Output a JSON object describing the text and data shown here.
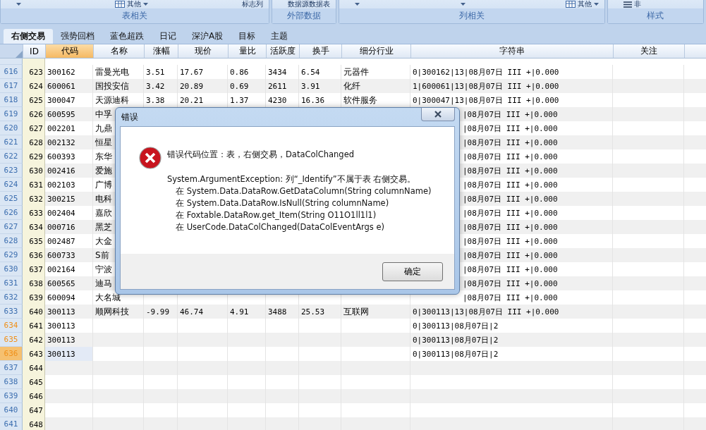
{
  "ribbon": {
    "groups": [
      {
        "label": "表相关",
        "items": [
          {
            "kind": "caret"
          },
          {
            "kind": "menu",
            "label": "其他"
          },
          {
            "kind": "text",
            "label": "标志列"
          }
        ]
      },
      {
        "label": "外部数据",
        "items": [
          {
            "kind": "text",
            "label": "数据源"
          },
          {
            "kind": "text",
            "label": "数据表"
          }
        ]
      },
      {
        "label": "列相关",
        "items": [
          {
            "kind": "caret"
          },
          {
            "kind": "caret"
          },
          {
            "kind": "menu",
            "label": "其他"
          }
        ]
      },
      {
        "label": "样式",
        "items": [
          {
            "kind": "list",
            "label": "非"
          }
        ]
      }
    ]
  },
  "tabs": [
    {
      "label": "右侧交易",
      "selected": true
    },
    {
      "label": "强势回档",
      "selected": false
    },
    {
      "label": "蓝色超跌",
      "selected": false
    },
    {
      "label": "日记",
      "selected": false
    },
    {
      "label": "深沪A股",
      "selected": false
    },
    {
      "label": "目标",
      "selected": false
    },
    {
      "label": "主题",
      "selected": false
    }
  ],
  "table": {
    "columns": [
      {
        "label": "ID",
        "selected": false
      },
      {
        "label": "代码",
        "selected": true
      },
      {
        "label": "名称",
        "selected": false
      },
      {
        "label": "涨幅",
        "selected": false
      },
      {
        "label": "现价",
        "selected": false
      },
      {
        "label": "量比",
        "selected": false
      },
      {
        "label": "活跃度",
        "selected": false
      },
      {
        "label": "换手",
        "selected": false
      },
      {
        "label": "细分行业",
        "selected": false
      },
      {
        "label": "字符串",
        "selected": false
      },
      {
        "label": "关注",
        "selected": false
      }
    ],
    "rows": [
      {
        "kind": "full",
        "no": "616",
        "id": "623",
        "code": "300162",
        "name": "雷曼光电",
        "change": "3.51",
        "price": "17.67",
        "volume_ratio": "0.86",
        "activity": "3434",
        "turnover": "6.54",
        "industry": "元器件",
        "string": "0|300162|13|08月07日 III +|0.000",
        "changed": false,
        "selected": false
      },
      {
        "kind": "full",
        "no": "617",
        "id": "624",
        "code": "600061",
        "name": "国投安信",
        "change": "3.42",
        "price": "20.89",
        "volume_ratio": "0.69",
        "activity": "2611",
        "turnover": "3.91",
        "industry": "化纤",
        "string": "1|600061|13|08月07日 III +|0.000",
        "changed": false,
        "selected": false
      },
      {
        "kind": "full",
        "no": "618",
        "id": "625",
        "code": "300047",
        "name": "天源迪科",
        "change": "3.38",
        "price": "20.21",
        "volume_ratio": "1.37",
        "activity": "4230",
        "turnover": "16.36",
        "industry": "软件服务",
        "string": "0|300047|13|08月07日 III +|0.000",
        "changed": false,
        "selected": false
      },
      {
        "kind": "covered",
        "no": "619",
        "id": "626",
        "code": "600595",
        "name": "中孚",
        "string": "|08月07日 III +|0.000",
        "changed": false,
        "selected": false
      },
      {
        "kind": "covered",
        "no": "620",
        "id": "627",
        "code": "002201",
        "name": "九鼎",
        "string": "|08月07日 III +|0.000",
        "changed": false,
        "selected": false
      },
      {
        "kind": "covered",
        "no": "621",
        "id": "628",
        "code": "002132",
        "name": "恒星",
        "string": "|08月07日 III +|0.000",
        "changed": false,
        "selected": false
      },
      {
        "kind": "covered",
        "no": "622",
        "id": "629",
        "code": "600393",
        "name": "东华",
        "string": "|08月07日 III +|0.000",
        "changed": false,
        "selected": false
      },
      {
        "kind": "covered",
        "no": "623",
        "id": "630",
        "code": "002416",
        "name": "爱施",
        "string": "|08月07日 III +|0.000",
        "changed": false,
        "selected": false
      },
      {
        "kind": "covered",
        "no": "624",
        "id": "631",
        "code": "002103",
        "name": "广博",
        "string": "|08月07日 III +|0.000",
        "changed": false,
        "selected": false
      },
      {
        "kind": "covered",
        "no": "625",
        "id": "632",
        "code": "300215",
        "name": "电科",
        "string": "|08月07日 III +|0.000",
        "changed": false,
        "selected": false
      },
      {
        "kind": "covered",
        "no": "626",
        "id": "633",
        "code": "002404",
        "name": "嘉欣",
        "string": "|08月07日 III +|0.000",
        "changed": false,
        "selected": false
      },
      {
        "kind": "covered",
        "no": "627",
        "id": "634",
        "code": "000716",
        "name": "黑芝",
        "string": "|08月07日 III +|0.000",
        "changed": false,
        "selected": false
      },
      {
        "kind": "covered",
        "no": "628",
        "id": "635",
        "code": "002487",
        "name": "大金",
        "string": "|08月07日 III +|0.000",
        "changed": false,
        "selected": false
      },
      {
        "kind": "covered",
        "no": "629",
        "id": "636",
        "code": "600733",
        "name": "S前",
        "string": "|08月07日 III +|0.000",
        "changed": false,
        "selected": false
      },
      {
        "kind": "covered",
        "no": "630",
        "id": "637",
        "code": "002164",
        "name": "宁波",
        "string": "|08月07日 III +|0.000",
        "changed": false,
        "selected": false
      },
      {
        "kind": "covered",
        "no": "631",
        "id": "638",
        "code": "600565",
        "name": "迪马",
        "string": "|08月07日 III +|0.000",
        "changed": false,
        "selected": false
      },
      {
        "kind": "covered",
        "no": "632",
        "id": "639",
        "code": "600094",
        "name": "大名城",
        "string": "|08月07日 III +|0.000",
        "changed": false,
        "selected": false
      },
      {
        "kind": "full",
        "no": "633",
        "id": "640",
        "code": "300113",
        "name": "顺网科技",
        "change": "-9.99",
        "price": "46.74",
        "volume_ratio": "4.91",
        "activity": "3488",
        "turnover": "25.53",
        "industry": "互联网",
        "string": "0|300113|13|08月07日 III +|0.000",
        "changed": false,
        "selected": false
      },
      {
        "kind": "full",
        "no": "634",
        "id": "641",
        "code": "300113",
        "string": "0|300113|08月07日|2",
        "changed": true,
        "selected": false
      },
      {
        "kind": "full",
        "no": "635",
        "id": "642",
        "code": "300113",
        "string": "0|300113|08月07日|2",
        "changed": true,
        "selected": false
      },
      {
        "kind": "full",
        "no": "636",
        "id": "643",
        "code": "300113",
        "string": "0|300113|08月07日|2",
        "changed": true,
        "selected": true
      },
      {
        "kind": "full",
        "no": "637",
        "id": "644",
        "changed": false,
        "selected": false
      },
      {
        "kind": "full",
        "no": "638",
        "id": "645",
        "changed": false,
        "selected": false
      },
      {
        "kind": "full",
        "no": "639",
        "id": "646",
        "changed": false,
        "selected": false
      },
      {
        "kind": "full",
        "no": "640",
        "id": "647",
        "changed": false,
        "selected": false
      },
      {
        "kind": "full",
        "no": "641",
        "id": "648",
        "changed": false,
        "selected": false
      }
    ]
  },
  "dialog": {
    "title": "错误",
    "heading": "错误代码位置：表，右侧交易，DataColChanged",
    "exception": "System.ArgumentException: 列“_Identify”不属于表 右侧交易。",
    "stack": [
      "在 System.Data.DataRow.GetDataColumn(String columnName)",
      "在 System.Data.DataRow.IsNull(String columnName)",
      "在 Foxtable.DataRow.get_Item(String O11O1ll1l1)",
      "在 UserCode.DataColChanged(DataColEventArgs e)"
    ],
    "button": "确定"
  }
}
